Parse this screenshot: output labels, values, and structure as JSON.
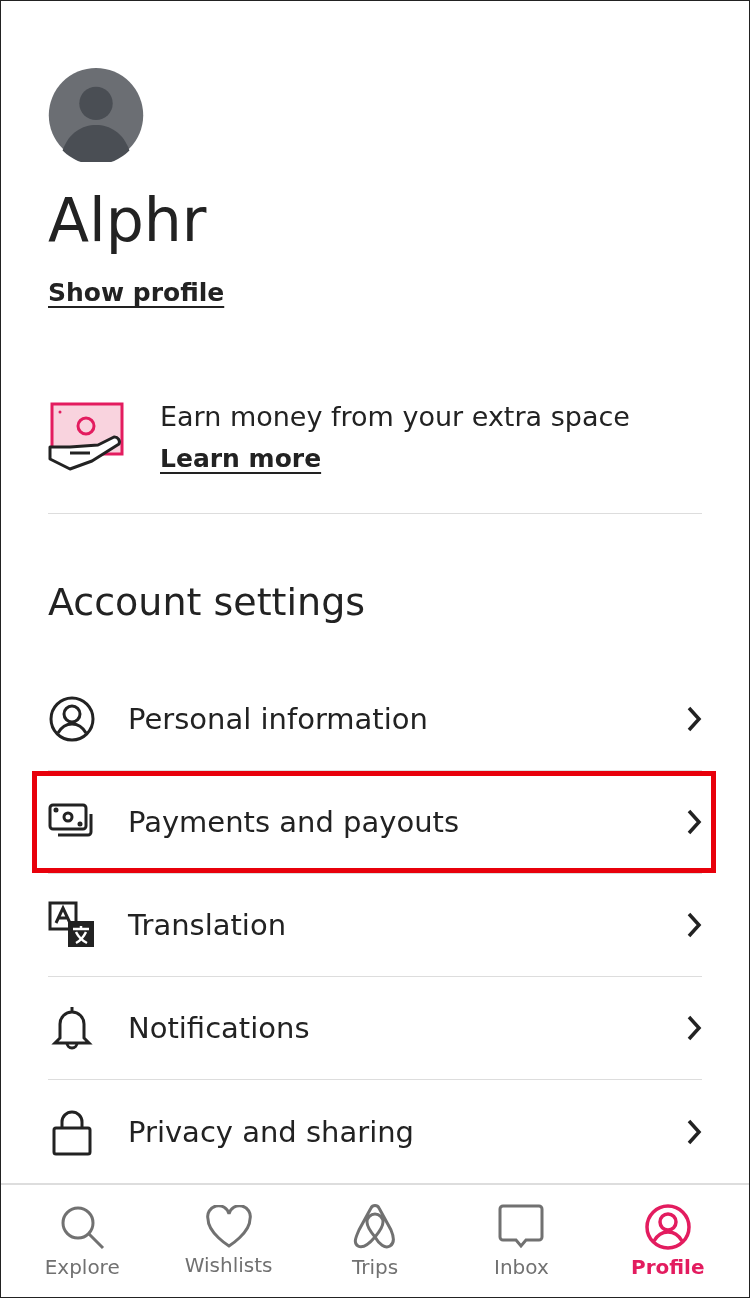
{
  "profile": {
    "name": "Alphr",
    "link": "Show profile"
  },
  "host_promo": {
    "text": "Earn money from your extra space",
    "link": "Learn more"
  },
  "account_settings": {
    "title": "Account settings",
    "items": [
      {
        "label": "Personal information",
        "highlighted": false
      },
      {
        "label": "Payments and payouts",
        "highlighted": true
      },
      {
        "label": "Translation",
        "highlighted": false
      },
      {
        "label": "Notifications",
        "highlighted": false
      },
      {
        "label": "Privacy and sharing",
        "highlighted": false
      }
    ]
  },
  "tab_bar": [
    {
      "label": "Explore",
      "selected": false
    },
    {
      "label": "Wishlists",
      "selected": false
    },
    {
      "label": "Trips",
      "selected": false
    },
    {
      "label": "Inbox",
      "selected": false
    },
    {
      "label": "Profile",
      "selected": true
    }
  ]
}
